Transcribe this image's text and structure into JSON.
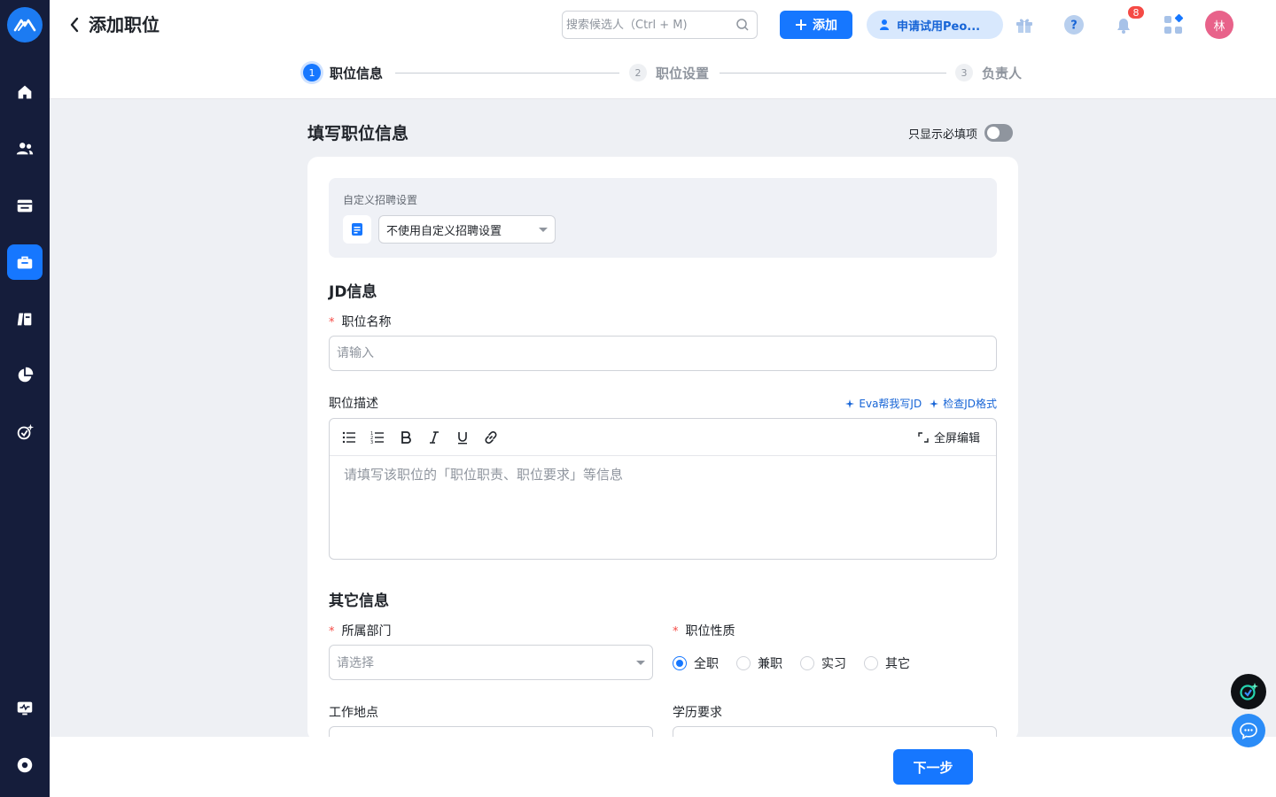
{
  "header": {
    "title": "添加职位",
    "search_placeholder": "搜索候选人（Ctrl + M)",
    "add_label": "添加",
    "trial_label": "申请试用Peo...",
    "notification_count": "8",
    "avatar_text": "林"
  },
  "steps": [
    {
      "num": "1",
      "label": "职位信息"
    },
    {
      "num": "2",
      "label": "职位设置"
    },
    {
      "num": "3",
      "label": "负责人"
    }
  ],
  "form": {
    "title": "填写职位信息",
    "required_toggle_label": "只显示必填项",
    "custom_settings": {
      "label": "自定义招聘设置",
      "selected": "不使用自定义招聘设置"
    },
    "jd_section": "JD信息",
    "job_name": {
      "required_mark": "*",
      "label": "职位名称",
      "placeholder": "请输入"
    },
    "job_desc": {
      "label": "职位描述",
      "ai_write": "Eva帮我写JD",
      "ai_check": "检查JD格式",
      "fullscreen": "全屏编辑",
      "placeholder": "请填写该职位的「职位职责、职位要求」等信息"
    },
    "other_section": "其它信息",
    "department": {
      "required_mark": "*",
      "label": "所属部门",
      "placeholder": "请选择"
    },
    "job_type": {
      "required_mark": "*",
      "label": "职位性质",
      "options": [
        "全职",
        "兼职",
        "实习",
        "其它"
      ],
      "selected": "全职"
    },
    "work_location": {
      "label": "工作地点"
    },
    "education": {
      "label": "学历要求"
    }
  },
  "footer": {
    "next_label": "下一步"
  },
  "colors": {
    "primary": "#1677ff",
    "sidebar": "#151d3b",
    "danger": "#f54a45"
  }
}
